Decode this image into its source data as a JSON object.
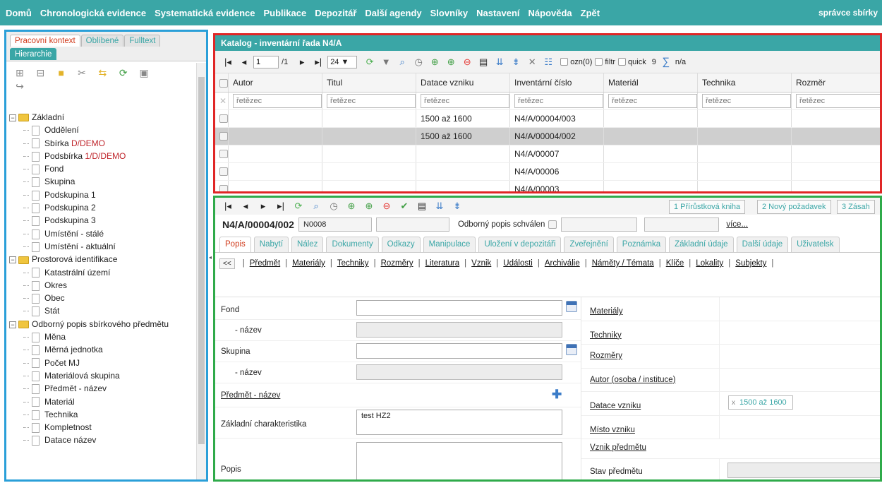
{
  "topbar": {
    "menu": [
      "Domů",
      "Chronologická evidence",
      "Systematická evidence",
      "Publikace",
      "Depozitář",
      "Další agendy",
      "Slovníky",
      "Nastavení",
      "Nápověda",
      "Zpět"
    ],
    "user": "správce sbírky"
  },
  "left": {
    "tabs": [
      "Pracovní kontext",
      "Oblíbené",
      "Fulltext",
      "Hierarchie"
    ],
    "tree": [
      {
        "type": "group",
        "label": "Základní"
      },
      {
        "type": "leaf",
        "label": "Oddělení"
      },
      {
        "type": "leaf",
        "label": "Sbírka ",
        "suffix": "D/DEMO"
      },
      {
        "type": "leaf",
        "label": "Podsbírka ",
        "suffix": "1/D/DEMO"
      },
      {
        "type": "leaf",
        "label": "Fond"
      },
      {
        "type": "leaf",
        "label": "Skupina"
      },
      {
        "type": "leaf",
        "label": "Podskupina 1"
      },
      {
        "type": "leaf",
        "label": "Podskupina 2"
      },
      {
        "type": "leaf",
        "label": "Podskupina 3"
      },
      {
        "type": "leaf",
        "label": "Umístění - stálé"
      },
      {
        "type": "leaf",
        "label": "Umístění - aktuální"
      },
      {
        "type": "group",
        "label": "Prostorová identifikace"
      },
      {
        "type": "leaf",
        "label": "Katastrální území"
      },
      {
        "type": "leaf",
        "label": "Okres"
      },
      {
        "type": "leaf",
        "label": "Obec"
      },
      {
        "type": "leaf",
        "label": "Stát"
      },
      {
        "type": "group",
        "label": "Odborný popis sbírkového předmětu"
      },
      {
        "type": "leaf",
        "label": "Měna"
      },
      {
        "type": "leaf",
        "label": "Měrná jednotka"
      },
      {
        "type": "leaf",
        "label": "Počet MJ"
      },
      {
        "type": "leaf",
        "label": "Materiálová skupina"
      },
      {
        "type": "leaf",
        "label": "Předmět - název"
      },
      {
        "type": "leaf",
        "label": "Materiál"
      },
      {
        "type": "leaf",
        "label": "Technika"
      },
      {
        "type": "leaf",
        "label": "Kompletnost"
      },
      {
        "type": "leaf",
        "label": "Datace název"
      }
    ]
  },
  "catalog": {
    "title": "Katalog - inventární řada N4/A",
    "page_value": "1",
    "page_total": "1",
    "page_size": "24 ▼",
    "ozn_label": "ozn(0)",
    "filtr_label": "filtr",
    "quick_label": "quick",
    "count": "9",
    "sum_label": "n/a",
    "columns": [
      "Autor",
      "Titul",
      "Datace vzniku",
      "Inventární číslo",
      "Materiál",
      "Technika",
      "Rozměr"
    ],
    "filter_placeholder": "řetězec",
    "rows": [
      [
        "",
        "",
        "1500 až 1600",
        "N4/A/00004/003",
        "",
        "",
        ""
      ],
      [
        "",
        "",
        "1500 až 1600",
        "N4/A/00004/002",
        "",
        "",
        ""
      ],
      [
        "",
        "",
        "",
        "N4/A/00007",
        "",
        "",
        ""
      ],
      [
        "",
        "",
        "",
        "N4/A/00006",
        "",
        "",
        ""
      ],
      [
        "",
        "",
        "",
        "N4/A/00003",
        "",
        "",
        ""
      ]
    ]
  },
  "detail": {
    "right_buttons": [
      "1 Přírůstková kniha",
      "2 Nový požadavek",
      "3 Zásah"
    ],
    "record_no": "N4/A/00004/002",
    "record_code": "N0008",
    "approved_label": "Odborný popis schválen",
    "more_link": "více...",
    "tabs": [
      "Popis",
      "Nabytí",
      "Nález",
      "Dokumenty",
      "Odkazy",
      "Manipulace",
      "Uložení v depozitáři",
      "Zveřejnění",
      "Poznámka",
      "Základní údaje",
      "Další údaje",
      "Uživatelsk"
    ],
    "back_label": "<<",
    "links": [
      "Předmět",
      "Materiály",
      "Techniky",
      "Rozměry",
      "Literatura",
      "Vznik",
      "Události",
      "Archiválie",
      "Náměty / Témata",
      "Klíče",
      "Lokality",
      "Subjekty"
    ],
    "form_left": {
      "fond": "Fond",
      "fond_nazev": "- název",
      "skupina": "Skupina",
      "skupina_nazev": "- název",
      "predmet_nazev": "Předmět - název",
      "zakladni": "Základní charakteristika",
      "zakladni_value": "test HZ2",
      "popis": "Popis"
    },
    "form_right": {
      "materialy": "Materiály",
      "techniky": "Techniky",
      "rozmery": "Rozměry",
      "autor": "Autor (osoba / instituce)",
      "datace": "Datace vzniku",
      "datace_value": "1500 až 1600",
      "misto": "Místo vzniku",
      "vznik": "Vznik předmětu",
      "stav": "Stav předmětu"
    }
  },
  "colors": {
    "accent": "#3aa6a6",
    "active_tab": "#d0391a",
    "red_frame": "#e02626",
    "green_frame": "#2faa4a",
    "blue_frame": "#2a9fd8"
  }
}
